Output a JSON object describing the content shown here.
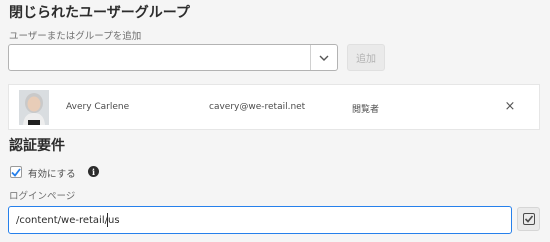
{
  "closed_groups": {
    "title": "閉じられたユーザーグループ",
    "add_label": "ユーザーまたはグループを追加",
    "add_input_value": "",
    "add_button": "追加",
    "members": [
      {
        "name": "Avery Carlene",
        "email": "cavery@we-retail.net",
        "role": "閲覧者",
        "remove": "×",
        "avatar": "avatar-photo"
      }
    ]
  },
  "auth": {
    "title": "認証要件",
    "enable_label": "有効にする",
    "enable_checked": true,
    "info_icon": "i",
    "login_page_label": "ログインページ",
    "login_page_value": "/content/we-retail/us"
  },
  "icons": {
    "dropdown": "chevron-down-icon",
    "remove": "close-icon",
    "checkmark": "checkmark-icon",
    "info": "info-icon"
  },
  "colors": {
    "background": "#f5f5f5",
    "accent": "#2680eb",
    "text": "#323232"
  }
}
